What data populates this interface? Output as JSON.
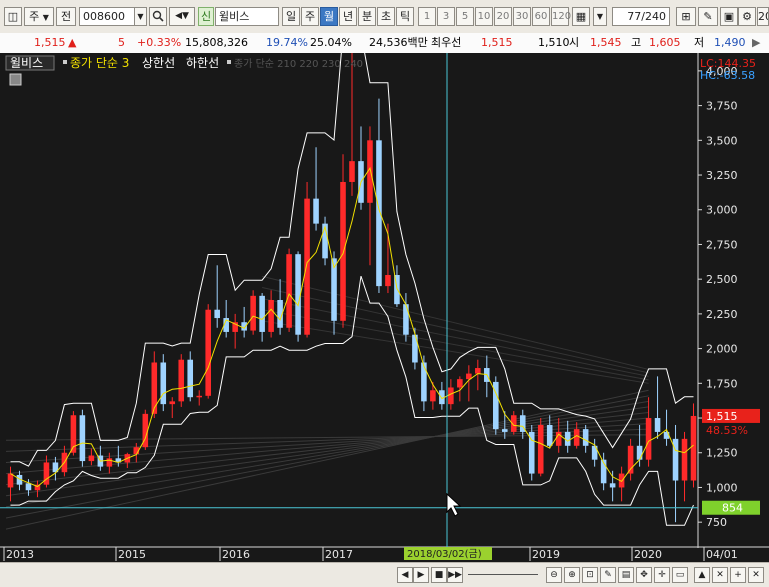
{
  "toolbar": {
    "mode_ju": "주",
    "mode_jeon": "전",
    "stock_code": "008600",
    "dropdown_arrow": "▼",
    "speaker": "◀▼",
    "new_badge": "신",
    "stock_name": "윌비스",
    "periods": [
      "일",
      "주",
      "월",
      "년",
      "분",
      "초",
      "틱"
    ],
    "active_period": "월",
    "intervals": [
      "1",
      "3",
      "5",
      "10",
      "20",
      "30",
      "60",
      "120"
    ],
    "count": "77",
    "count_total": "/240",
    "right_value": "20"
  },
  "info": {
    "price": "1,515",
    "change_arrow": "▲",
    "change": "5",
    "change_pct": "+0.33%",
    "volume": "15,808,326",
    "pct1": "19.74%",
    "pct2": "25.04%",
    "amount": "24,536백만",
    "prev_label": "최우선",
    "prev_value": "1,515",
    "best_value": "1,510",
    "open_label": "시",
    "open_value": "1,545",
    "high_label": "고",
    "high_value": "1,605",
    "low_label": "저",
    "low_value": "1,490"
  },
  "legend": {
    "name": "윌비스",
    "ma": "종가 단순 3",
    "upper": "상한선",
    "lower": "하한선",
    "extra": "종가 단순 210 220 230 240"
  },
  "labels": {
    "lc": "LC:144.35",
    "hc": "HC:-63.58",
    "price_tag": "1,515",
    "pct_tag": "48.53%",
    "cursor_tag": "854",
    "cursor_date": "2018/03/02(금)"
  },
  "chart_data": {
    "type": "candlestick",
    "y_ticks": [
      750,
      1000,
      1250,
      1500,
      1750,
      2000,
      2250,
      2500,
      2750,
      3000,
      3250,
      3500,
      3750,
      4000
    ],
    "ylim": [
      600,
      4100
    ],
    "x_labels": [
      "2013",
      "2015",
      "2016",
      "2017",
      "2019",
      "2020",
      "04/01"
    ],
    "colors": {
      "up": "#ff2a2a",
      "down": "#9fd3ff",
      "ma": "#f2e000",
      "band": "#ffffff",
      "cursor": "#4ac6d6",
      "tag_red": "#e8221b",
      "tag_green": "#7fd12c"
    },
    "candles": [
      {
        "o": 1000,
        "h": 1150,
        "l": 900,
        "c": 1100
      },
      {
        "o": 1090,
        "h": 1120,
        "l": 980,
        "c": 1020
      },
      {
        "o": 1030,
        "h": 1060,
        "l": 940,
        "c": 980
      },
      {
        "o": 980,
        "h": 1050,
        "l": 930,
        "c": 1020
      },
      {
        "o": 1020,
        "h": 1230,
        "l": 1000,
        "c": 1180
      },
      {
        "o": 1180,
        "h": 1220,
        "l": 1050,
        "c": 1110
      },
      {
        "o": 1110,
        "h": 1300,
        "l": 1080,
        "c": 1250
      },
      {
        "o": 1250,
        "h": 1550,
        "l": 1230,
        "c": 1520
      },
      {
        "o": 1520,
        "h": 1560,
        "l": 1150,
        "c": 1190
      },
      {
        "o": 1190,
        "h": 1280,
        "l": 1160,
        "c": 1230
      },
      {
        "o": 1230,
        "h": 1300,
        "l": 1120,
        "c": 1150
      },
      {
        "o": 1150,
        "h": 1250,
        "l": 1100,
        "c": 1210
      },
      {
        "o": 1210,
        "h": 1300,
        "l": 1150,
        "c": 1180
      },
      {
        "o": 1180,
        "h": 1250,
        "l": 1140,
        "c": 1240
      },
      {
        "o": 1240,
        "h": 1320,
        "l": 1180,
        "c": 1290
      },
      {
        "o": 1290,
        "h": 1560,
        "l": 1270,
        "c": 1530
      },
      {
        "o": 1530,
        "h": 1980,
        "l": 1500,
        "c": 1900
      },
      {
        "o": 1900,
        "h": 1960,
        "l": 1550,
        "c": 1600
      },
      {
        "o": 1600,
        "h": 1650,
        "l": 1500,
        "c": 1620
      },
      {
        "o": 1620,
        "h": 1960,
        "l": 1580,
        "c": 1920
      },
      {
        "o": 1920,
        "h": 1980,
        "l": 1620,
        "c": 1650
      },
      {
        "o": 1650,
        "h": 1700,
        "l": 1590,
        "c": 1660
      },
      {
        "o": 1660,
        "h": 2320,
        "l": 1640,
        "c": 2280
      },
      {
        "o": 2280,
        "h": 2600,
        "l": 2150,
        "c": 2220
      },
      {
        "o": 2220,
        "h": 2350,
        "l": 2080,
        "c": 2120
      },
      {
        "o": 2120,
        "h": 2250,
        "l": 2000,
        "c": 2190
      },
      {
        "o": 2190,
        "h": 2300,
        "l": 2080,
        "c": 2130
      },
      {
        "o": 2130,
        "h": 2420,
        "l": 2100,
        "c": 2380
      },
      {
        "o": 2380,
        "h": 2400,
        "l": 2050,
        "c": 2120
      },
      {
        "o": 2120,
        "h": 2420,
        "l": 2080,
        "c": 2350
      },
      {
        "o": 2350,
        "h": 2500,
        "l": 2100,
        "c": 2150
      },
      {
        "o": 2150,
        "h": 2720,
        "l": 2120,
        "c": 2680
      },
      {
        "o": 2680,
        "h": 2700,
        "l": 2050,
        "c": 2100
      },
      {
        "o": 2100,
        "h": 3200,
        "l": 2080,
        "c": 3080
      },
      {
        "o": 3080,
        "h": 3450,
        "l": 2850,
        "c": 2900
      },
      {
        "o": 2900,
        "h": 2950,
        "l": 2600,
        "c": 2650
      },
      {
        "o": 2650,
        "h": 2700,
        "l": 2100,
        "c": 2200
      },
      {
        "o": 2200,
        "h": 3400,
        "l": 2150,
        "c": 3200
      },
      {
        "o": 3200,
        "h": 4150,
        "l": 3100,
        "c": 3350
      },
      {
        "o": 3350,
        "h": 3600,
        "l": 3000,
        "c": 3050
      },
      {
        "o": 3050,
        "h": 3600,
        "l": 2600,
        "c": 3500
      },
      {
        "o": 3500,
        "h": 3800,
        "l": 2400,
        "c": 2450
      },
      {
        "o": 2450,
        "h": 2900,
        "l": 2400,
        "c": 2530
      },
      {
        "o": 2530,
        "h": 2600,
        "l": 2300,
        "c": 2320
      },
      {
        "o": 2320,
        "h": 2400,
        "l": 2050,
        "c": 2100
      },
      {
        "o": 2100,
        "h": 2150,
        "l": 1850,
        "c": 1900
      },
      {
        "o": 1900,
        "h": 1950,
        "l": 1550,
        "c": 1620
      },
      {
        "o": 1620,
        "h": 1760,
        "l": 1560,
        "c": 1700
      },
      {
        "o": 1700,
        "h": 1760,
        "l": 1560,
        "c": 1600
      },
      {
        "o": 1600,
        "h": 1780,
        "l": 1560,
        "c": 1720
      },
      {
        "o": 1720,
        "h": 1800,
        "l": 1620,
        "c": 1780
      },
      {
        "o": 1780,
        "h": 1880,
        "l": 1620,
        "c": 1820
      },
      {
        "o": 1820,
        "h": 1920,
        "l": 1700,
        "c": 1860
      },
      {
        "o": 1860,
        "h": 1950,
        "l": 1650,
        "c": 1760
      },
      {
        "o": 1760,
        "h": 1800,
        "l": 1380,
        "c": 1420
      },
      {
        "o": 1420,
        "h": 1550,
        "l": 1350,
        "c": 1400
      },
      {
        "o": 1400,
        "h": 1550,
        "l": 1380,
        "c": 1520
      },
      {
        "o": 1520,
        "h": 1560,
        "l": 1350,
        "c": 1400
      },
      {
        "o": 1400,
        "h": 1450,
        "l": 1050,
        "c": 1100
      },
      {
        "o": 1100,
        "h": 1500,
        "l": 1080,
        "c": 1450
      },
      {
        "o": 1450,
        "h": 1520,
        "l": 1280,
        "c": 1300
      },
      {
        "o": 1300,
        "h": 1500,
        "l": 1250,
        "c": 1400
      },
      {
        "o": 1400,
        "h": 1480,
        "l": 1250,
        "c": 1300
      },
      {
        "o": 1300,
        "h": 1470,
        "l": 1280,
        "c": 1420
      },
      {
        "o": 1420,
        "h": 1450,
        "l": 1250,
        "c": 1300
      },
      {
        "o": 1300,
        "h": 1350,
        "l": 1150,
        "c": 1200
      },
      {
        "o": 1200,
        "h": 1250,
        "l": 980,
        "c": 1030
      },
      {
        "o": 1030,
        "h": 1120,
        "l": 900,
        "c": 1000
      },
      {
        "o": 1000,
        "h": 1150,
        "l": 900,
        "c": 1100
      },
      {
        "o": 1100,
        "h": 1350,
        "l": 1050,
        "c": 1300
      },
      {
        "o": 1300,
        "h": 1450,
        "l": 1150,
        "c": 1200
      },
      {
        "o": 1200,
        "h": 1650,
        "l": 1150,
        "c": 1500
      },
      {
        "o": 1500,
        "h": 1800,
        "l": 1350,
        "c": 1400
      },
      {
        "o": 1400,
        "h": 1560,
        "l": 1300,
        "c": 1350
      },
      {
        "o": 1350,
        "h": 1450,
        "l": 750,
        "c": 1050
      },
      {
        "o": 1050,
        "h": 1400,
        "l": 900,
        "c": 1350
      },
      {
        "o": 1050,
        "h": 1605,
        "l": 1000,
        "c": 1515
      }
    ],
    "ma3_series_name": "종가 단순 3",
    "upper_series_name": "상한선",
    "lower_series_name": "하한선",
    "crosshair_price": 854,
    "crosshair_date": "2018/03/02(금)"
  }
}
